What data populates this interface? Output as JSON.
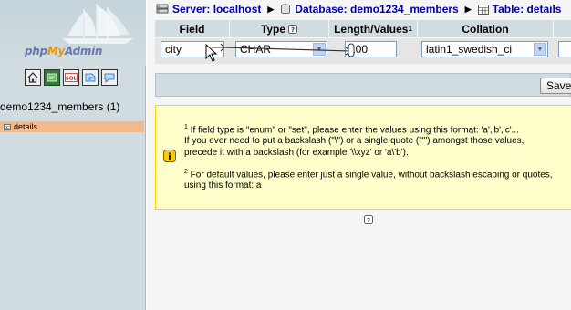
{
  "nav": {
    "logo": {
      "php": "php",
      "my": "My",
      "admin": "Admin"
    },
    "icons": [
      "home-icon",
      "query-window-icon",
      "sql-icon",
      "docs-icon",
      "help-icon"
    ],
    "database": "demo1234_members (1)",
    "tables": [
      {
        "label": "details"
      }
    ]
  },
  "breadcrumb": {
    "server": "Server: localhost",
    "database": "Database: demo1234_members",
    "table": "Table: details"
  },
  "form": {
    "headers": {
      "field": "Field",
      "type": "Type",
      "length": "Length/Values",
      "length_sup": "1",
      "collation": "Collation"
    },
    "row": {
      "field_value": "city",
      "type_value": "CHAR",
      "length_value": "100",
      "collation_value": "latin1_swedish_ci"
    },
    "save_label": "Save"
  },
  "notice": {
    "fn1_marker": "1",
    "line1": " If field type is \"enum\" or \"set\", please enter the values using this format: 'a','b','c'...",
    "line2": "If you ever need to put a backslash (\"\\\") or a single quote (\"'\") amongst those values,",
    "line3": "precede it with a backslash (for example '\\\\xyz' or 'a\\'b').",
    "fn2_marker": "2",
    "line4": " For default values, please enter just a single value, without backslash escaping or quotes,",
    "line5": "using this format: a"
  },
  "colors": {
    "nav_bg": "#d0dce0",
    "table_highlight": "#f4ba8c",
    "link": "#0000aa",
    "notice_bg": "#ffffcc",
    "notice_border": "#ffd700"
  }
}
